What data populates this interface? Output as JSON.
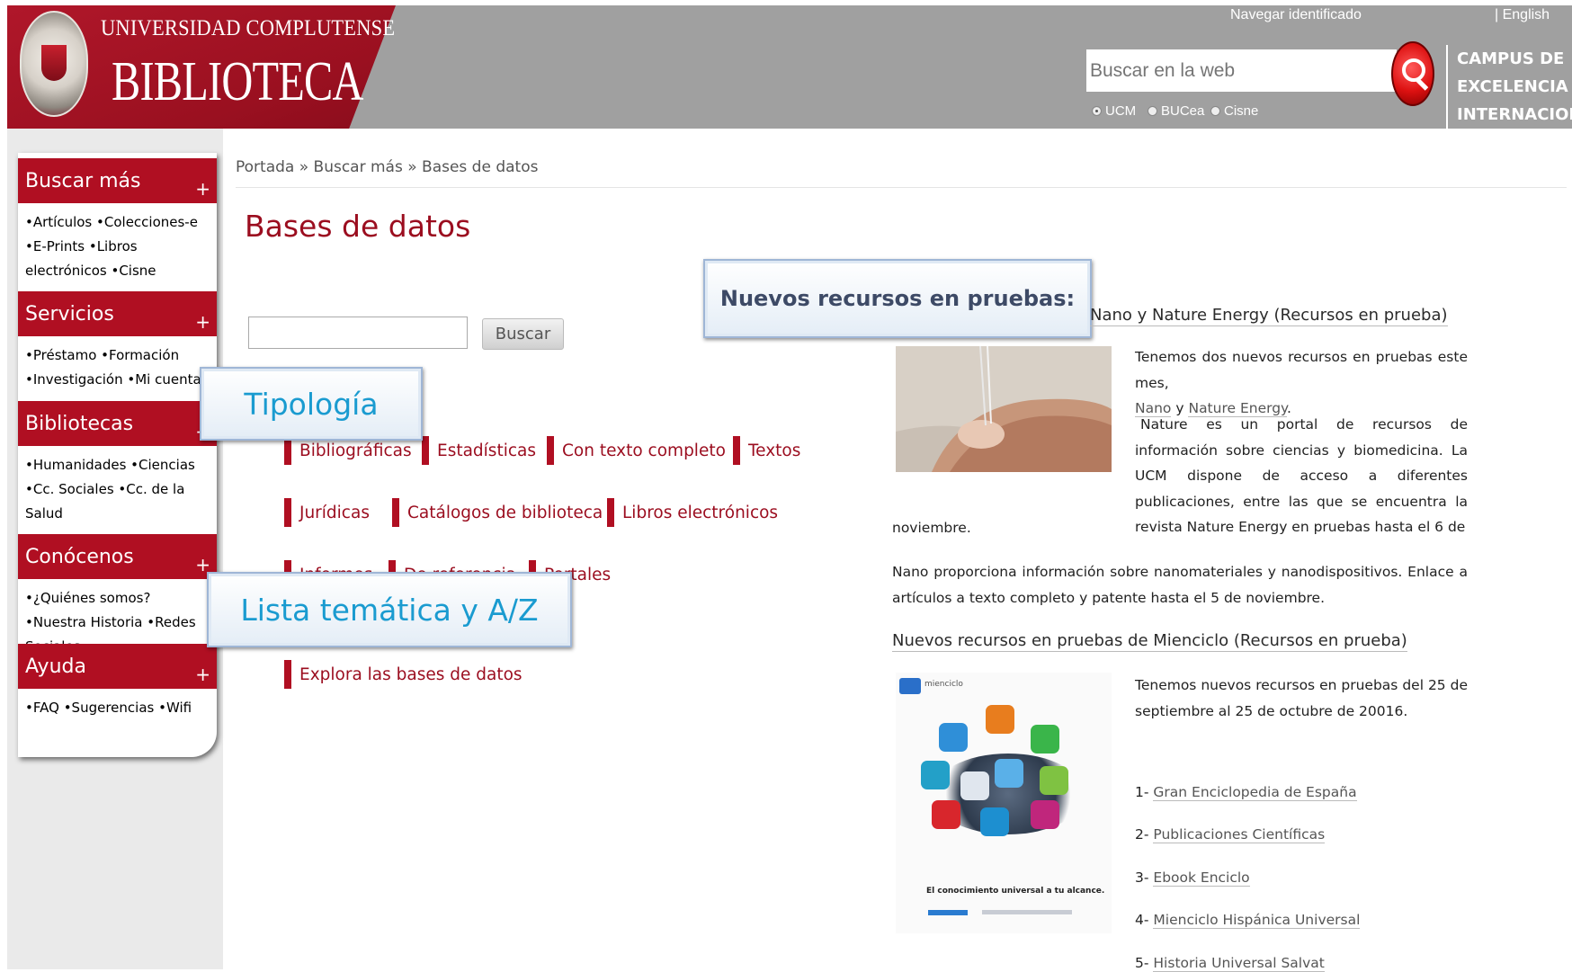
{
  "header": {
    "university": "UNIVERSIDAD COMPLUTENSE",
    "library": "BIBLIOTECA",
    "login_link": "Navegar identificado",
    "lang_link": "| English",
    "search_placeholder": "Buscar en la web",
    "scope_options": [
      "UCM",
      "BUCea",
      "Cisne"
    ],
    "scope_selected": "UCM",
    "campus_lines": [
      "CAMPUS DE",
      "EXCELENCIA",
      "INTERNACIONAL"
    ]
  },
  "sidebar": {
    "sections": [
      {
        "title": "Buscar más",
        "items": [
          "Artículos",
          "Colecciones-e",
          "E-Prints",
          "Libros electrónicos",
          "Cisne"
        ]
      },
      {
        "title": "Servicios",
        "items": [
          "Préstamo",
          "Formación",
          "Investigación",
          "Mi cuenta"
        ]
      },
      {
        "title": "Bibliotecas",
        "items": [
          "Humanidades",
          "Ciencias",
          "Cc. Sociales",
          "Cc. de la Salud"
        ]
      },
      {
        "title": "Conócenos",
        "items": [
          "¿Quiénes somos?",
          "Nuestra Historia",
          "Redes Sociales"
        ]
      },
      {
        "title": "Ayuda",
        "items": [
          "FAQ",
          "Sugerencias",
          "Wifi"
        ]
      }
    ]
  },
  "main": {
    "breadcrumb": "Portada » Buscar más » Bases de datos",
    "title": "Bases de datos",
    "search_button": "Buscar",
    "categories": [
      "Bibliográficas",
      "Estadísticas",
      "Con texto completo",
      "Textos",
      "Jurídicas",
      "Catálogos de biblioteca",
      "Libros electrónicos",
      "Informes",
      "De referencia",
      "Portales"
    ],
    "explore_link": "Explora las bases de datos"
  },
  "callouts": {
    "tipologia": "Tipología",
    "tematica": "Lista temática y A/Z",
    "nuevos": "Nuevos recursos en pruebas:"
  },
  "news": {
    "item1_title": "Nano y Nature Energy (Recursos en prueba)",
    "item1_intro": "Tenemos dos nuevos recursos en pruebas este mes,",
    "item1_link_nano": "Nano",
    "item1_and": "y",
    "item1_link_nature": "Nature Energy",
    "item1_p2": "Nature es un portal de recursos de información sobre ciencias y biomedicina. La UCM dispone de acceso a diferentes publicaciones, entre las que se encuentra la revista Nature Energy en pruebas hasta el 6 de",
    "item1_p2_end": "noviembre.",
    "item1_p3": "Nano proporciona información sobre nanomateriales y nanodispositivos. Enlace a artículos a texto completo y patente hasta el 5 de noviembre.",
    "item2_title": "Nuevos recursos en pruebas de Mienciclo (Recursos en prueba)",
    "item2_intro": "Tenemos nuevos recursos en pruebas del 25 de septiembre al 25 de octubre de 20016.",
    "item2_list": [
      {
        "num": "1-",
        "label": "Gran Enciclopedia de España"
      },
      {
        "num": "2-",
        "label": "Publicaciones Científicas"
      },
      {
        "num": "3-",
        "label": "Ebook Enciclo"
      },
      {
        "num": "4-",
        "label": "Mienciclo Hispánica Universal"
      },
      {
        "num": "5-",
        "label": "Historia Universal Salvat"
      }
    ],
    "mienciclo_brand": "mienciclo",
    "mienciclo_tagline": "El conocimiento universal a tu alcance."
  }
}
